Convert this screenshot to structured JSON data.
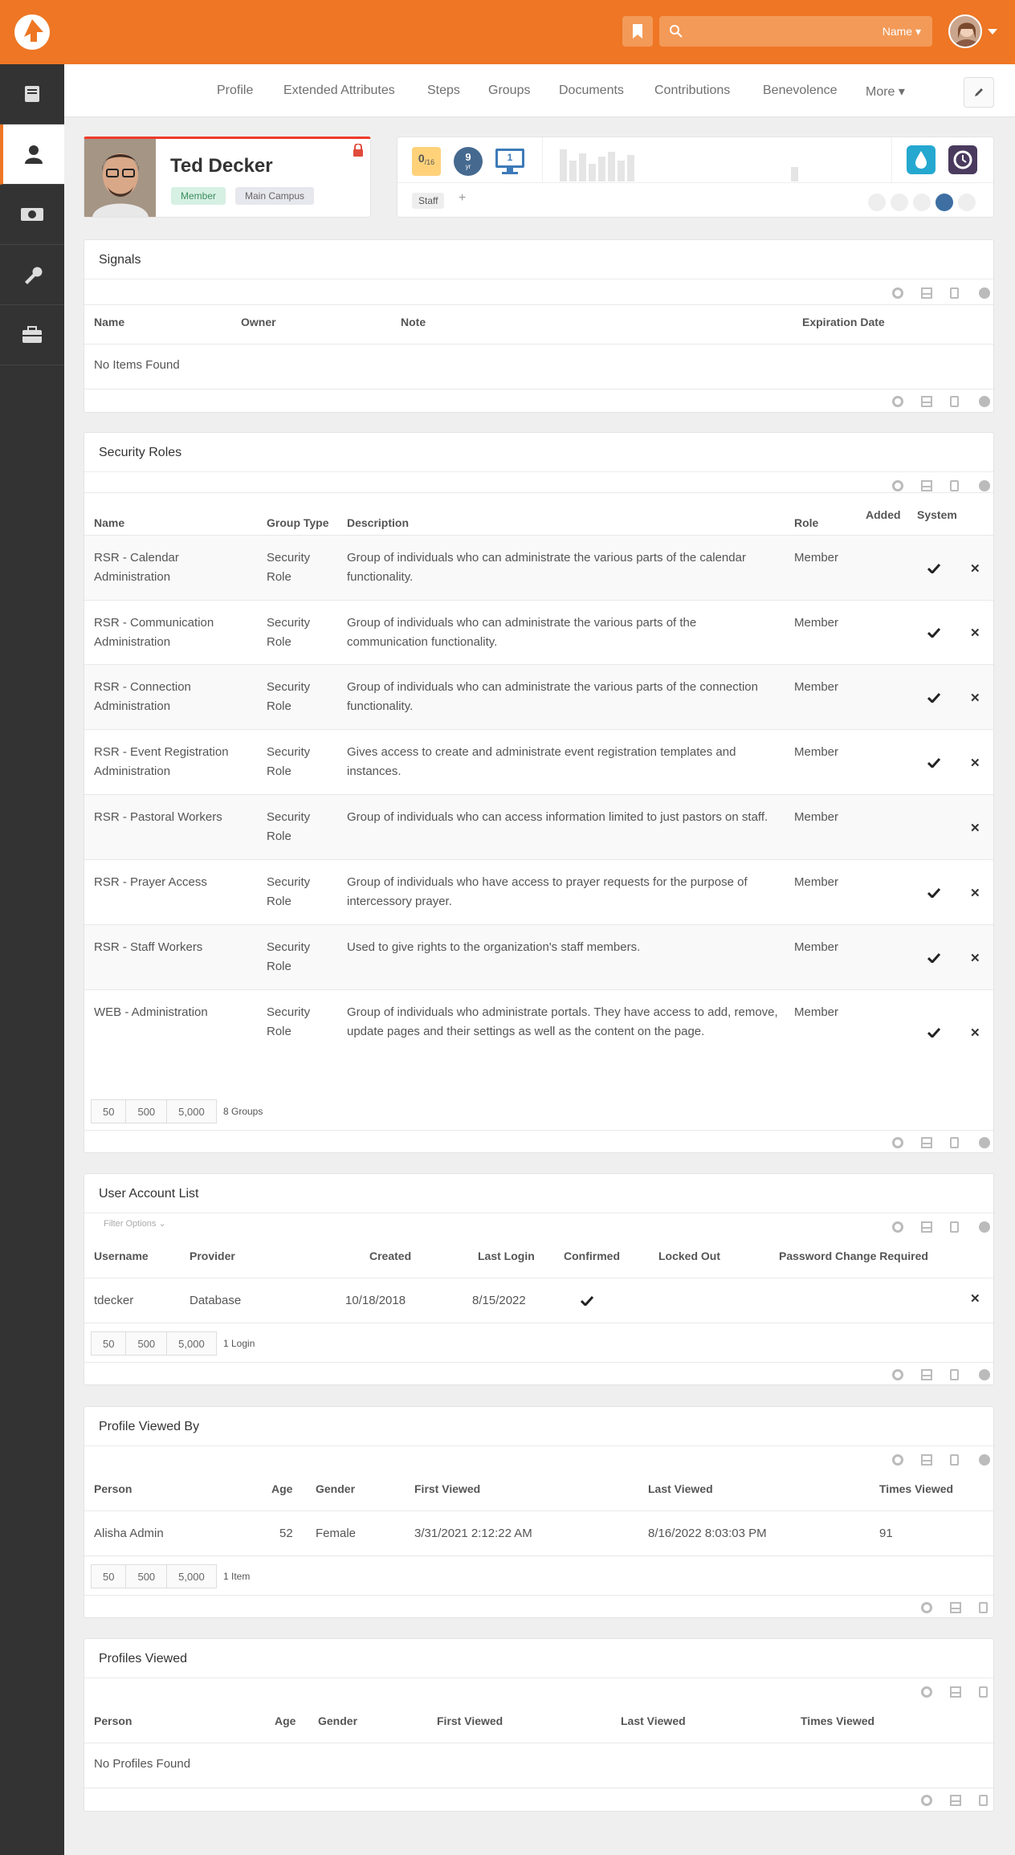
{
  "header": {
    "search_type": "Name ▾"
  },
  "subnav": {
    "tabs": [
      "Profile",
      "Extended Attributes",
      "Steps",
      "Groups",
      "Documents",
      "Contributions",
      "Benevolence",
      "More ▾"
    ]
  },
  "profile": {
    "name": "Ted Decker",
    "badges": [
      "Member",
      "Main Campus"
    ]
  },
  "badges_card": {
    "progress": "0",
    "progress_total": "/16",
    "years": "9",
    "years_unit": "yr",
    "screen_count": "1",
    "tag": "Staff",
    "add": "+"
  },
  "signals": {
    "title": "Signals",
    "columns": [
      "Name",
      "Owner",
      "Note",
      "Expiration Date"
    ],
    "empty": "No Items Found"
  },
  "security": {
    "title": "Security Roles",
    "columns": [
      "Name",
      "Group Type",
      "Description",
      "Role",
      "Added",
      "System"
    ],
    "rows": [
      {
        "name": "RSR - Calendar Administration",
        "type": "Security Role",
        "desc": "Group of individuals who can administrate the various parts of the calendar functionality.",
        "role": "Member",
        "system": true
      },
      {
        "name": "RSR - Communication Administration",
        "type": "Security Role",
        "desc": "Group of individuals who can administrate the various parts of the communication functionality.",
        "role": "Member",
        "system": true
      },
      {
        "name": "RSR - Connection Administration",
        "type": "Security Role",
        "desc": "Group of individuals who can administrate the various parts of the connection functionality.",
        "role": "Member",
        "system": true
      },
      {
        "name": "RSR - Event Registration Administration",
        "type": "Security Role",
        "desc": "Gives access to create and administrate event registration templates and instances.",
        "role": "Member",
        "system": true
      },
      {
        "name": "RSR - Pastoral Workers",
        "type": "Security Role",
        "desc": "Group of individuals who can access information limited to just pastors on staff.",
        "role": "Member",
        "system": false
      },
      {
        "name": "RSR - Prayer Access",
        "type": "Security Role",
        "desc": "Group of individuals who have access to prayer requests for the purpose of intercessory prayer.",
        "role": "Member",
        "system": true
      },
      {
        "name": "RSR - Staff Workers",
        "type": "Security Role",
        "desc": "Used to give rights to the organization's staff members.",
        "role": "Member",
        "system": true
      },
      {
        "name": "WEB - Administration",
        "type": "Security Role",
        "desc": "Group of individuals who administrate portals. They have access to add, remove, update pages and their settings as well as the content on the page.",
        "role": "Member",
        "system": true
      }
    ],
    "pager": [
      "50",
      "500",
      "5,000"
    ],
    "count": "8 Groups"
  },
  "accounts": {
    "title": "User Account List",
    "filter": "Filter Options ⌄",
    "columns": [
      "Username",
      "Provider",
      "Created",
      "Last Login",
      "Confirmed",
      "Locked Out",
      "Password Change Required"
    ],
    "rows": [
      {
        "username": "tdecker",
        "provider": "Database",
        "created": "10/18/2018",
        "last_login": "8/15/2022"
      }
    ],
    "pager": [
      "50",
      "500",
      "5,000"
    ],
    "count": "1 Login"
  },
  "viewed_by": {
    "title": "Profile Viewed By",
    "columns": [
      "Person",
      "Age",
      "Gender",
      "First Viewed",
      "Last Viewed",
      "Times Viewed"
    ],
    "rows": [
      {
        "person": "Alisha Admin",
        "age": "52",
        "gender": "Female",
        "first": "3/31/2021 2:12:22 AM",
        "last": "8/16/2022 8:03:03 PM",
        "times": "91"
      }
    ],
    "pager": [
      "50",
      "500",
      "5,000"
    ],
    "count": "1 Item"
  },
  "viewed": {
    "title": "Profiles Viewed",
    "columns": [
      "Person",
      "Age",
      "Gender",
      "First Viewed",
      "Last Viewed",
      "Times Viewed"
    ],
    "empty": "No Profiles Found"
  },
  "colors": {
    "brand": "#ee7624",
    "sidebar": "#333333"
  }
}
